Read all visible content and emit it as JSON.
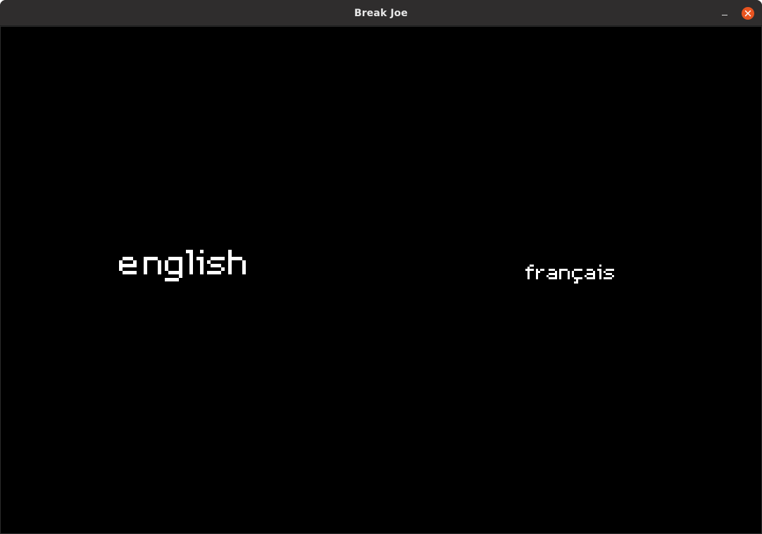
{
  "window": {
    "title": "Break Joe",
    "minimize_icon": "minimize-icon",
    "close_icon": "close-icon",
    "close_color": "#e95420"
  },
  "game": {
    "background": "#000000",
    "text_color": "#ffffff",
    "languages": [
      {
        "label": "english",
        "selected": true
      },
      {
        "label": "français",
        "selected": false
      }
    ]
  }
}
